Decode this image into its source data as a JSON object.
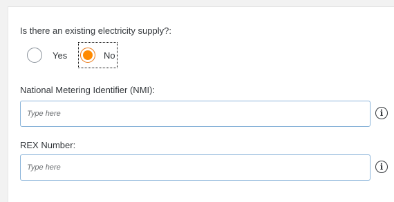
{
  "form": {
    "supply_question": "Is there an existing electricity supply?:",
    "options": [
      {
        "label": "Yes",
        "selected": false
      },
      {
        "label": "No",
        "selected": true
      }
    ],
    "nmi": {
      "label": "National Metering Identifier (NMI):",
      "placeholder": "Type here",
      "value": "",
      "info_icon": "i"
    },
    "rex": {
      "label": "REX Number:",
      "placeholder": "Type here",
      "value": "",
      "info_icon": "i"
    }
  },
  "colors": {
    "accent": "#ff8a00",
    "input_border": "#89b3d9",
    "text": "#32363a"
  }
}
